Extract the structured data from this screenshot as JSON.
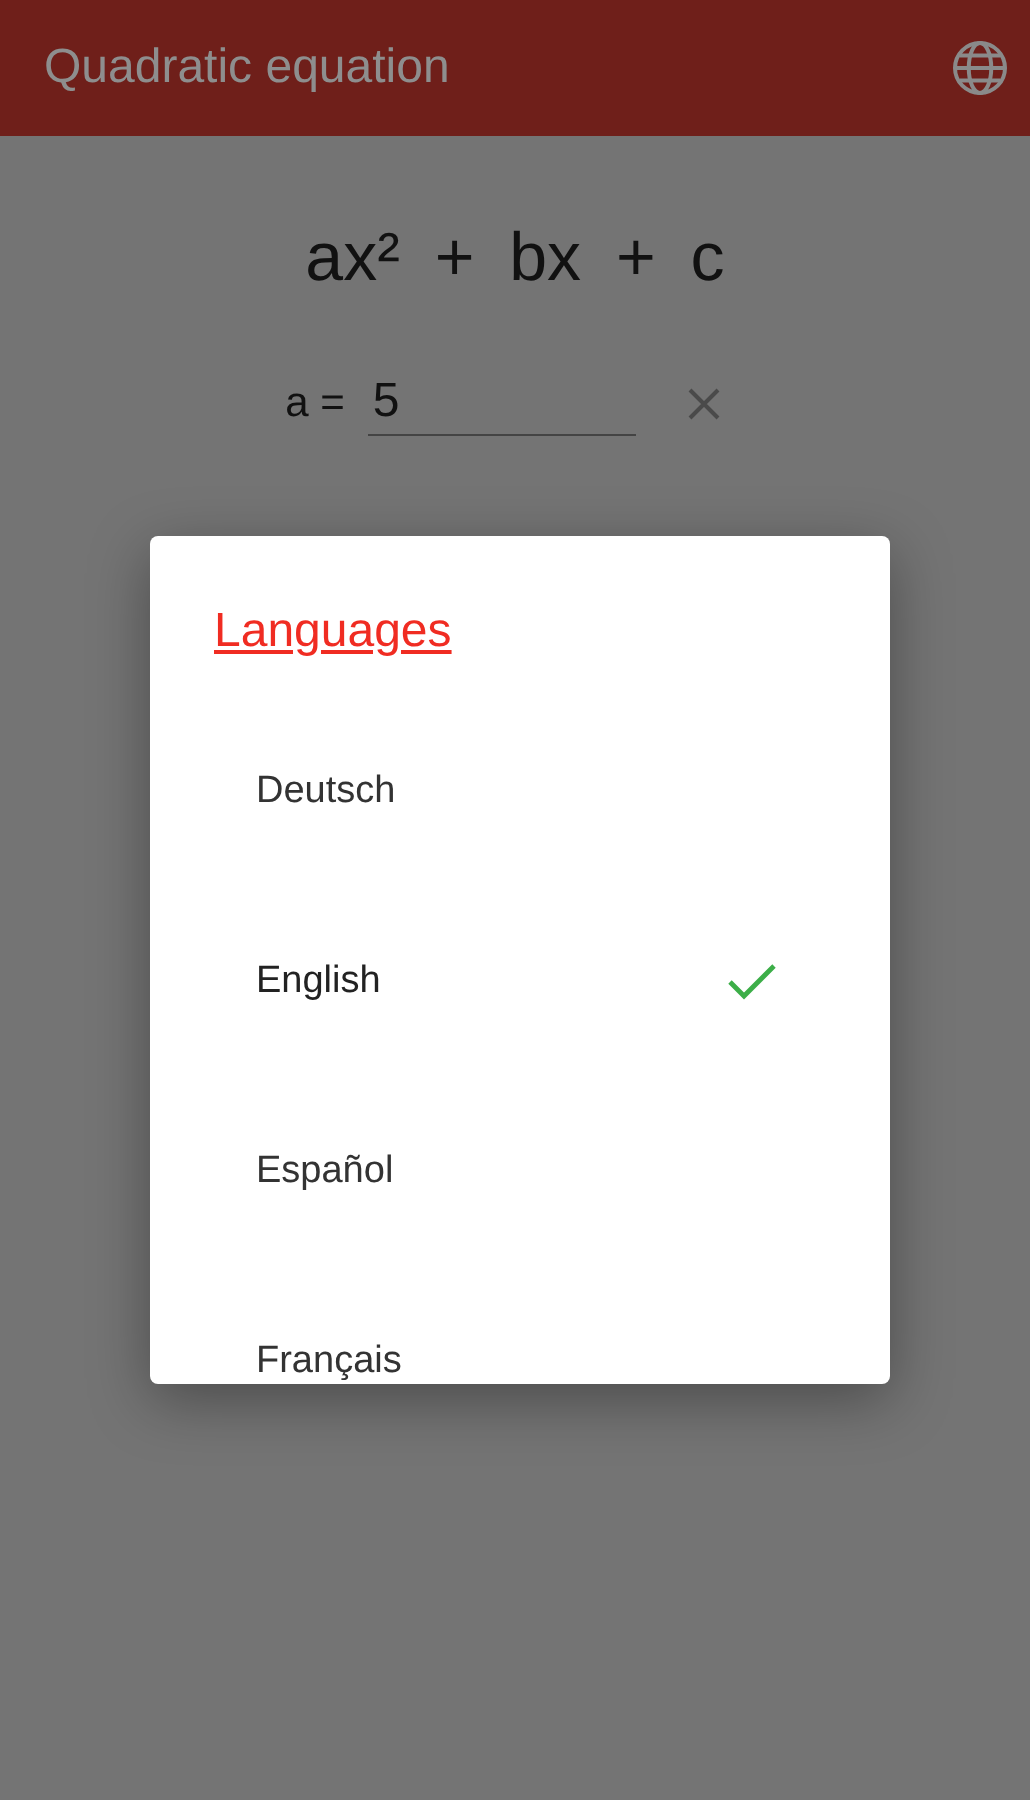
{
  "app_bar": {
    "title": "Quadratic equation"
  },
  "formula": {
    "text": "ax² + bx + c"
  },
  "coefficient": {
    "label": "a =",
    "value": "5"
  },
  "dialog": {
    "title": "Languages",
    "items": [
      {
        "label": "Deutsch",
        "selected": false
      },
      {
        "label": "English",
        "selected": true
      },
      {
        "label": "Español",
        "selected": false
      },
      {
        "label": "Français",
        "selected": false
      }
    ]
  }
}
